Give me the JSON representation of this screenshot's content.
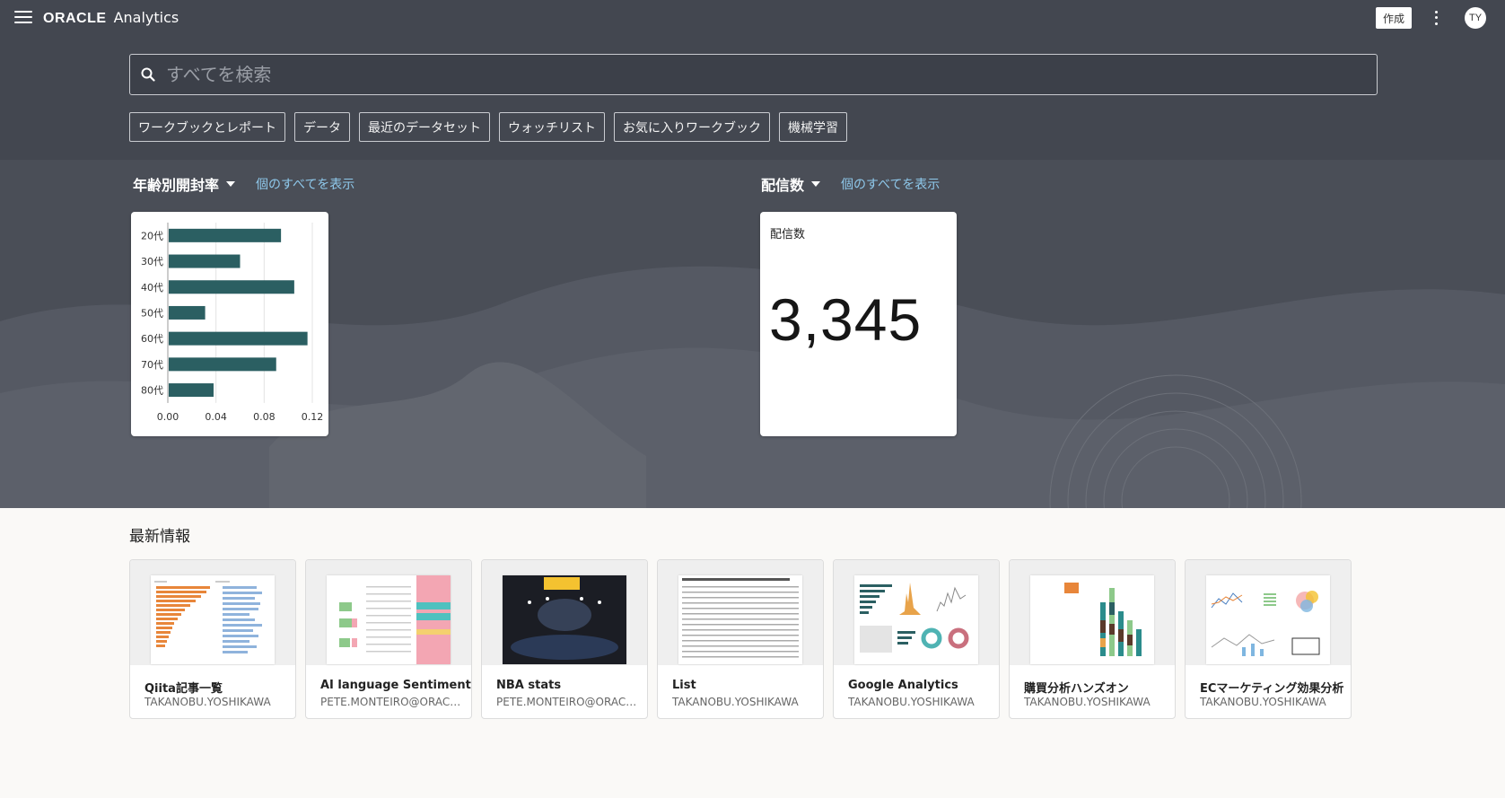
{
  "header": {
    "brand_logo": "ORACLE",
    "brand_product": "Analytics",
    "create_label": "作成",
    "user_initials": "TY"
  },
  "search": {
    "placeholder": "すべてを検索"
  },
  "chips": [
    "ワークブックとレポート",
    "データ",
    "最近のデータセット",
    "ウォッチリスト",
    "お気に入りワークブック",
    "機械学習"
  ],
  "watch": {
    "chart_section": {
      "title": "年齢別開封率",
      "link": "個のすべてを表示"
    },
    "kpi_section": {
      "title": "配信数",
      "link": "個のすべてを表示"
    },
    "kpi": {
      "label": "配信数",
      "value": "3,345"
    }
  },
  "chart_data": {
    "type": "bar",
    "orientation": "horizontal",
    "categories": [
      "20代",
      "30代",
      "40代",
      "50代",
      "60代",
      "70代",
      "80代"
    ],
    "values": [
      0.094,
      0.06,
      0.105,
      0.031,
      0.116,
      0.09,
      0.038
    ],
    "xlim": [
      0,
      0.12
    ],
    "xticks": [
      "0.00",
      "0.04",
      "0.08",
      "0.12"
    ],
    "grid": true,
    "color": "#2b5f62"
  },
  "recent": {
    "title": "最新情報",
    "items": [
      {
        "name": "Qiita記事一覧",
        "owner": "TAKANOBU.YOSHIKAWA"
      },
      {
        "name": "AI language Sentiment",
        "owner": "PETE.MONTEIRO@ORACLE.COM"
      },
      {
        "name": "NBA stats",
        "owner": "PETE.MONTEIRO@ORACLE.COM"
      },
      {
        "name": "List",
        "owner": "TAKANOBU.YOSHIKAWA"
      },
      {
        "name": "Google Analytics",
        "owner": "TAKANOBU.YOSHIKAWA"
      },
      {
        "name": "購買分析ハンズオン",
        "owner": "TAKANOBU.YOSHIKAWA"
      },
      {
        "name": "ECマーケティング効果分析",
        "owner": "TAKANOBU.YOSHIKAWA"
      }
    ]
  }
}
